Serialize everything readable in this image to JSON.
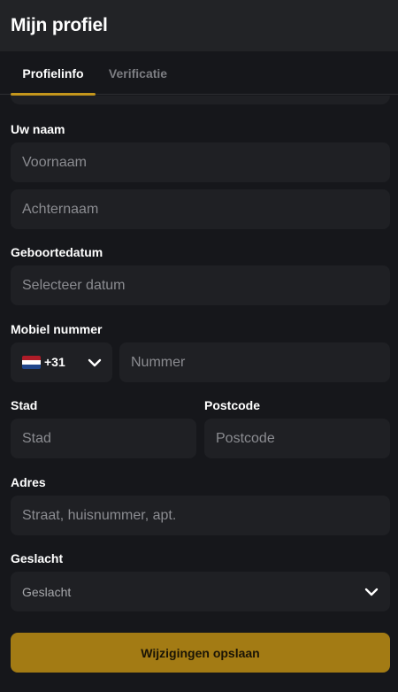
{
  "header": {
    "title": "Mijn profiel"
  },
  "tabs": [
    {
      "label": "Profielinfo",
      "active": true
    },
    {
      "label": "Verificatie",
      "active": false
    }
  ],
  "form": {
    "name": {
      "label": "Uw naam",
      "first_placeholder": "Voornaam",
      "last_placeholder": "Achternaam"
    },
    "birthdate": {
      "label": "Geboortedatum",
      "placeholder": "Selecteer datum"
    },
    "mobile": {
      "label": "Mobiel nummer",
      "country_code": "+31",
      "country_flag_icon": "netherlands-flag-icon",
      "placeholder": "Nummer"
    },
    "city": {
      "label": "Stad",
      "placeholder": "Stad"
    },
    "postcode": {
      "label": "Postcode",
      "placeholder": "Postcode"
    },
    "address": {
      "label": "Adres",
      "placeholder": "Straat, huisnummer, apt."
    },
    "gender": {
      "label": "Geslacht",
      "selected": "Geslacht"
    },
    "save_label": "Wijzigingen opslaan"
  },
  "colors": {
    "background": "#16171b",
    "header": "#222326",
    "field": "#1f2024",
    "accent": "#c4961c",
    "button": "#a37b14"
  }
}
